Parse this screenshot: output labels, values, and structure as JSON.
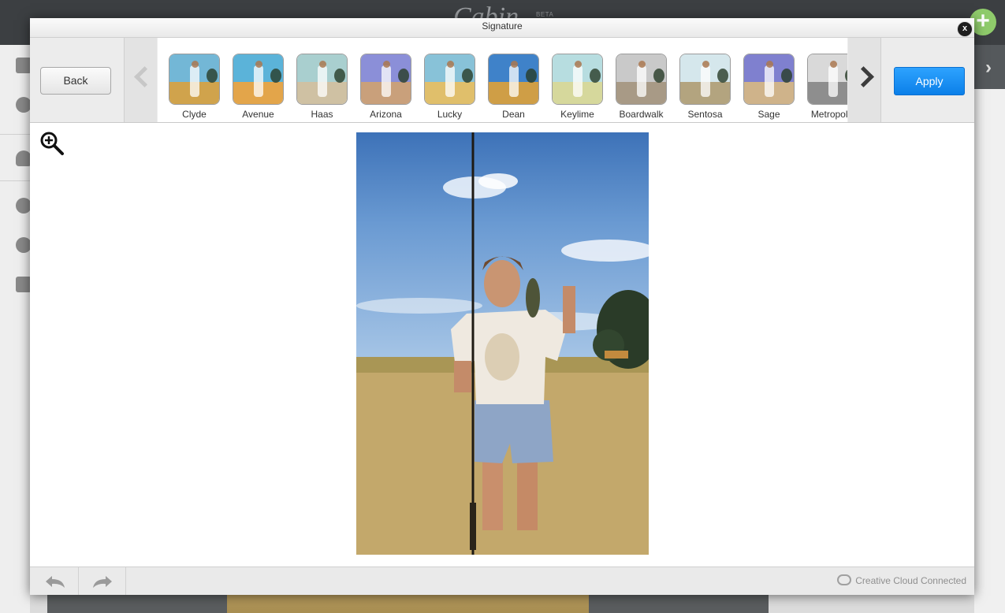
{
  "background": {
    "app_logo": "Cabin",
    "beta_badge": "BETA"
  },
  "dialog": {
    "title": "Signature",
    "close_label": "x"
  },
  "toolbar": {
    "back_label": "Back",
    "apply_label": "Apply",
    "filters": [
      {
        "label": "Clyde",
        "sky": "#73b7d6",
        "ground": "#d0a34c"
      },
      {
        "label": "Avenue",
        "sky": "#5bb3d9",
        "ground": "#e3a54a"
      },
      {
        "label": "Haas",
        "sky": "#a9cfcf",
        "ground": "#cfc1a3"
      },
      {
        "label": "Arizona",
        "sky": "#8b8fd8",
        "ground": "#c9a07b"
      },
      {
        "label": "Lucky",
        "sky": "#88c2d8",
        "ground": "#e0bf6b"
      },
      {
        "label": "Dean",
        "sky": "#3f82c9",
        "ground": "#cf9e46"
      },
      {
        "label": "Keylime",
        "sky": "#b7dde0",
        "ground": "#d6d89c"
      },
      {
        "label": "Boardwalk",
        "sky": "#c9c9c9",
        "ground": "#a89a86"
      },
      {
        "label": "Sentosa",
        "sky": "#d5e7ec",
        "ground": "#b3a47f"
      },
      {
        "label": "Sage",
        "sky": "#7f80cf",
        "ground": "#cfb38a"
      },
      {
        "label": "Metropolis",
        "sky": "#d9d9d9",
        "ground": "#8e8e8e"
      }
    ]
  },
  "footer": {
    "status": "Creative Cloud Connected"
  }
}
